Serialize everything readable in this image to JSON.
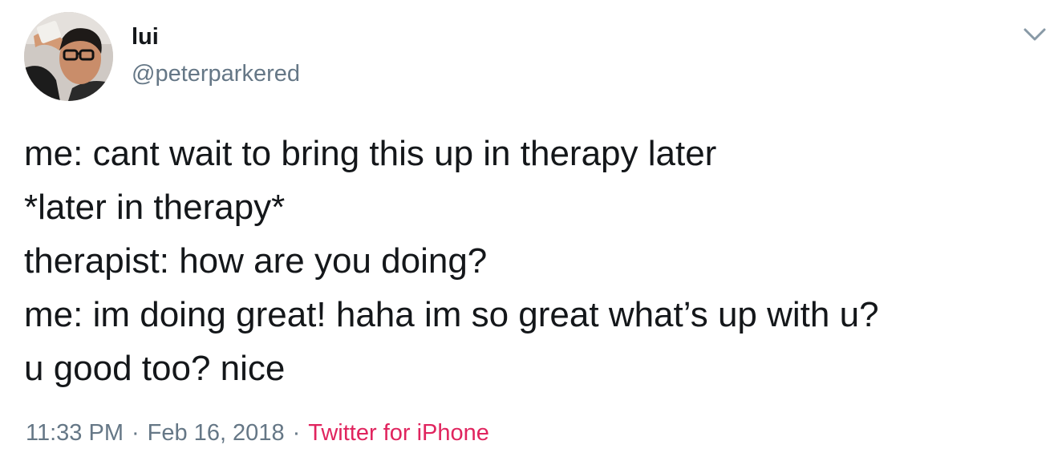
{
  "author": {
    "display_name": "lui",
    "handle": "@peterparkered"
  },
  "tweet": {
    "lines": [
      "me: cant wait to bring this up in therapy later",
      "*later in therapy*",
      "therapist: how are you doing?",
      "me: im doing great! haha im so great what’s up with u?",
      "u good too? nice"
    ]
  },
  "meta": {
    "time": "11:33 PM",
    "separator": "·",
    "date": "Feb 16, 2018",
    "source": "Twitter for iPhone"
  },
  "icons": {
    "caret": "chevron-down-icon"
  },
  "colors": {
    "text": "#14171a",
    "secondary": "#657786",
    "source_link": "#e0245e"
  }
}
